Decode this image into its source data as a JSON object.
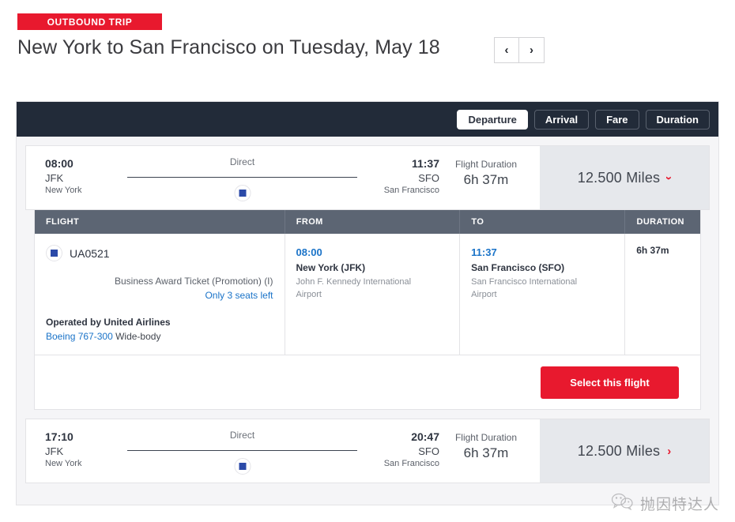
{
  "header": {
    "badge": "OUTBOUND TRIP",
    "title": "New York to San Francisco on Tuesday, May 18",
    "prev_icon": "chevron-left-icon",
    "next_icon": "chevron-right-icon",
    "prev_glyph": "‹",
    "next_glyph": "›"
  },
  "sort_bar": {
    "options": [
      {
        "label": "Departure",
        "active": true
      },
      {
        "label": "Arrival",
        "active": false
      },
      {
        "label": "Fare",
        "active": false
      },
      {
        "label": "Duration",
        "active": false
      }
    ]
  },
  "flights": [
    {
      "depart_time": "08:00",
      "depart_code": "JFK",
      "depart_city": "New York",
      "stops": "Direct",
      "arrive_time": "11:37",
      "arrive_code": "SFO",
      "arrive_city": "San Francisco",
      "duration_label": "Flight Duration",
      "duration_value": "6h 37m",
      "price": "12.500 Miles",
      "expanded": true,
      "chevron_glyph": "›"
    },
    {
      "depart_time": "17:10",
      "depart_code": "JFK",
      "depart_city": "New York",
      "stops": "Direct",
      "arrive_time": "20:47",
      "arrive_code": "SFO",
      "arrive_city": "San Francisco",
      "duration_label": "Flight Duration",
      "duration_value": "6h 37m",
      "price": "12.500 Miles",
      "expanded": false,
      "chevron_glyph": "›"
    }
  ],
  "details": {
    "columns": [
      "FLIGHT",
      "FROM",
      "TO",
      "DURATION"
    ],
    "row": {
      "flight_number": "UA0521",
      "fare_name": "Business Award Ticket (Promotion) (I)",
      "seats_left": "Only 3 seats left",
      "operated_by": "Operated by United Airlines",
      "aircraft_link": "Boeing 767-300",
      "aircraft_type": " Wide-body",
      "from_time": "08:00",
      "from_airport": "New York (JFK)",
      "from_full": "John F. Kennedy International Airport",
      "to_time": "11:37",
      "to_airport": "San Francisco (SFO)",
      "to_full": "San Francisco International Airport",
      "duration": "6h 37m"
    },
    "select_label": "Select this flight"
  },
  "watermark": {
    "icon": "wechat-icon",
    "text": "抛因特达人"
  }
}
